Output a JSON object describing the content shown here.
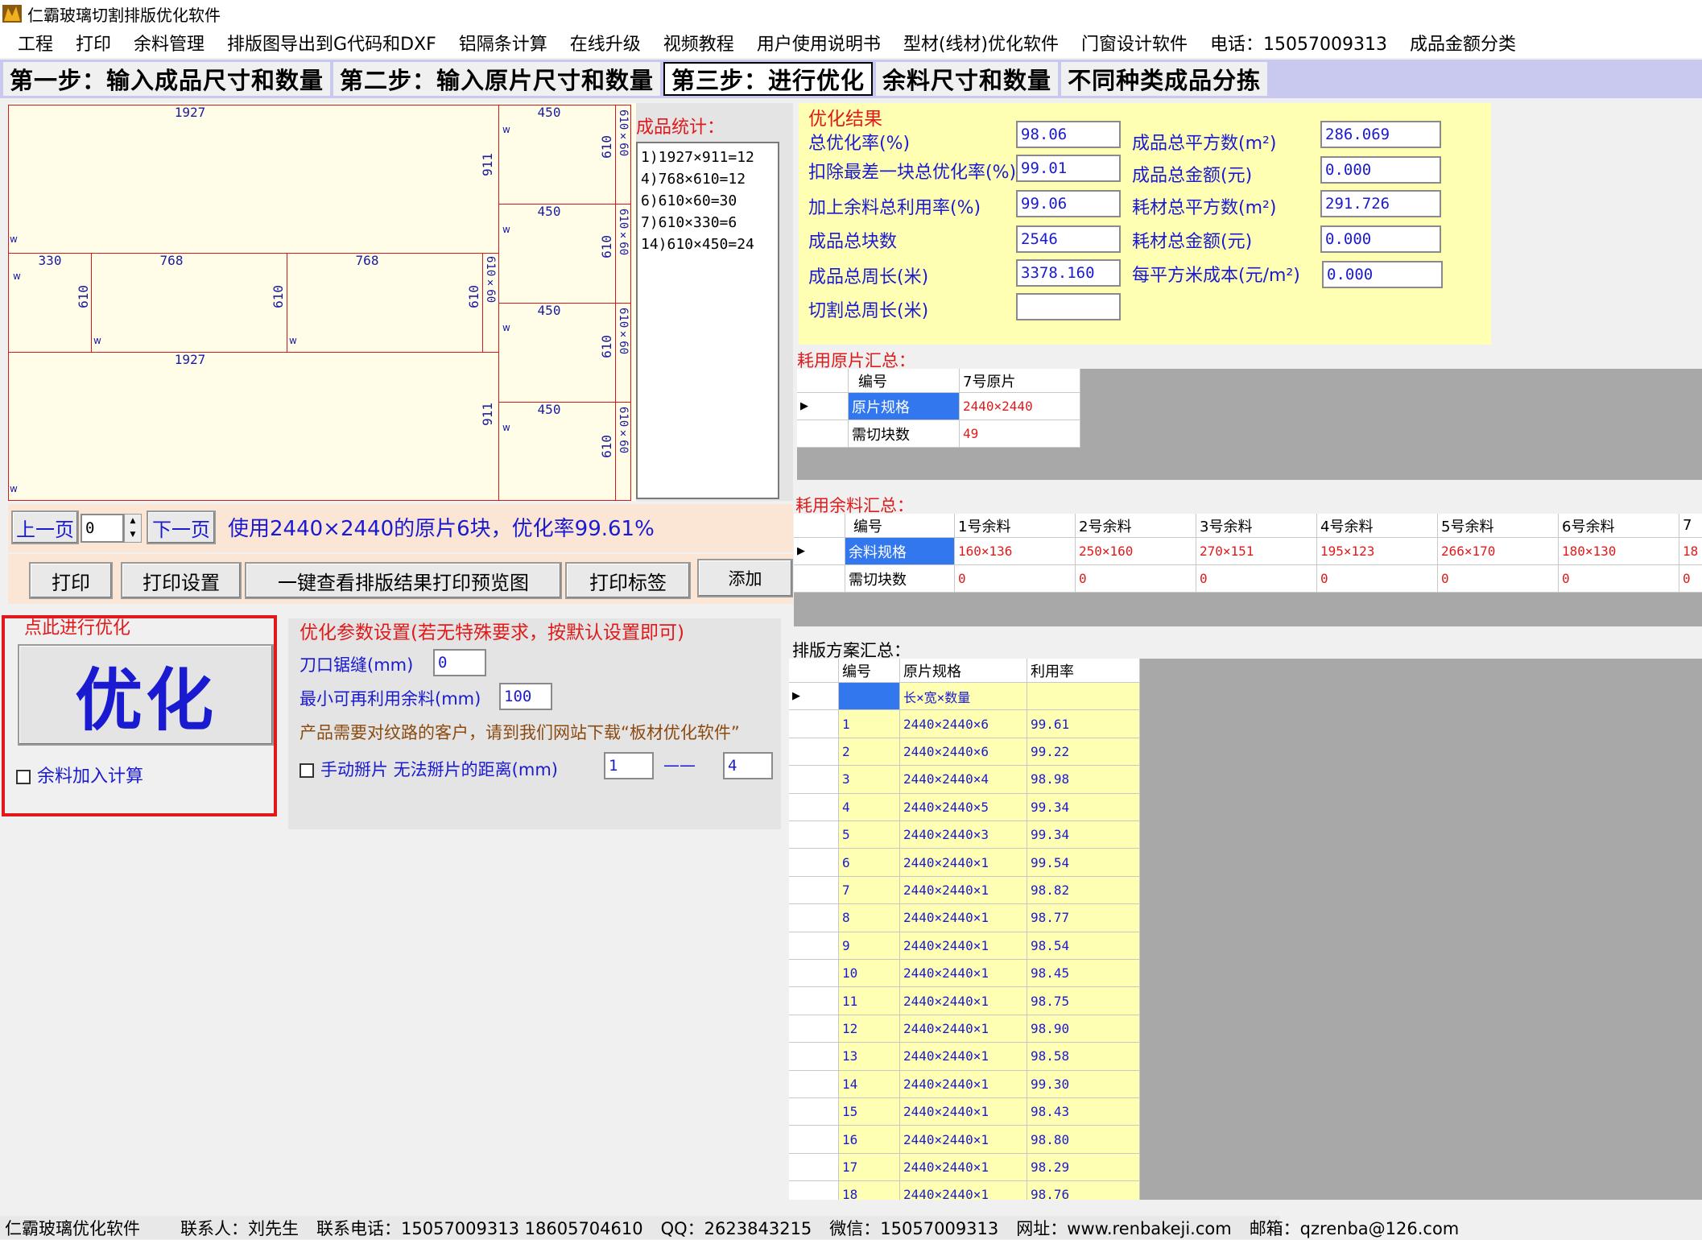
{
  "window": {
    "title": "仁霸玻璃切割排版优化软件"
  },
  "menu": [
    "工程",
    "打印",
    "余料管理",
    "排版图导出到G代码和DXF",
    "铝隔条计算",
    "在线升级",
    "视频教程",
    "用户使用说明书",
    "型材(线材)优化软件",
    "门窗设计软件",
    "电话：15057009313",
    "成品金额分类"
  ],
  "tabs": [
    "第一步：输入成品尺寸和数量",
    "第二步：输入原片尺寸和数量",
    "第三步：进行优化",
    "余料尺寸和数量",
    "不同种类成品分拣"
  ],
  "layout": {
    "pieces": {
      "p1": "1927",
      "p2": "911",
      "p3": "330",
      "p4": "610",
      "p5": "768",
      "p6": "610",
      "p7": "768",
      "p8": "610",
      "p9": "1927",
      "p10": "911",
      "p11": "450",
      "p12": "610",
      "p13": "450",
      "p14": "610",
      "p15": "450",
      "p16": "610",
      "p17": "450",
      "p18": "610",
      "p19": "610×60",
      "p20": "610×60",
      "p21": "610×60",
      "p22": "610×60",
      "p23": "610×60",
      "w": "w"
    }
  },
  "stats": {
    "label": "成品统计：",
    "items": [
      "1)1927×911=12",
      "4)768×610=12",
      "6)610×60=30",
      "7)610×330=6",
      "14)610×450=24"
    ]
  },
  "nav": {
    "prev": "上一页",
    "page": "0",
    "next": "下一页",
    "summary": "使用2440×2440的原片6块，优化率99.61%"
  },
  "buttons": {
    "print": "打印",
    "print_settings": "打印设置",
    "preview": "一键查看排版结果打印预览图",
    "print_label": "打印标签",
    "add": "添加"
  },
  "optimize": {
    "caption": "点此进行优化",
    "button": "优化",
    "checkbox": "余料加入计算"
  },
  "params": {
    "title": "优化参数设置(若无特殊要求，按默认设置即可)",
    "kerf_label": "刀口锯缝(mm)",
    "kerf": "0",
    "minrem_label": "最小可再利用余料(mm)",
    "minrem": "100",
    "note": "产品需要对纹路的客户，请到我们网站下载“板材优化软件”",
    "manual_label": "手动掰片 无法掰片的距离(mm)",
    "dist_from": "1",
    "dash": "——",
    "dist_to": "4"
  },
  "results": {
    "title": "优化结果",
    "left": [
      {
        "label": "总优化率(%)",
        "value": "98.06"
      },
      {
        "label": "扣除最差一块总优化率(%)",
        "value": "99.01"
      },
      {
        "label": "加上余料总利用率(%)",
        "value": "99.06"
      },
      {
        "label": "成品总块数",
        "value": "2546"
      },
      {
        "label": "成品总周长(米)",
        "value": "3378.160"
      },
      {
        "label": "切割总周长(米)",
        "value": ""
      }
    ],
    "right": [
      {
        "label": "成品总平方数(m²)",
        "value": "286.069"
      },
      {
        "label": "成品总金额(元)",
        "value": "0.000"
      },
      {
        "label": "耗材总平方数(m²)",
        "value": "291.726"
      },
      {
        "label": "耗材总金额(元)",
        "value": "0.000"
      },
      {
        "label": "每平方米成本(元/m²)",
        "value": "0.000"
      }
    ]
  },
  "raw": {
    "title": "耗用原片汇总：",
    "h0": "编号",
    "h1": "7号原片",
    "r1": "原片规格",
    "v1": "2440×2440",
    "r2": "需切块数",
    "v2": "49"
  },
  "remnant": {
    "title": "耗用余料汇总：",
    "h0": "编号",
    "headers": [
      "1号余料",
      "2号余料",
      "3号余料",
      "4号余料",
      "5号余料",
      "6号余料",
      "7"
    ],
    "r1": "余料规格",
    "specs": [
      "160×136",
      "250×160",
      "270×151",
      "195×123",
      "266×170",
      "180×130",
      "18"
    ],
    "r2": "需切块数",
    "counts": [
      "0",
      "0",
      "0",
      "0",
      "0",
      "0",
      "0"
    ]
  },
  "plans": {
    "title": "排版方案汇总：",
    "headers": [
      "编号",
      "原片规格",
      "利用率"
    ],
    "first": "长×宽×数量",
    "rows": [
      [
        "1",
        "2440×2440×6",
        "99.61"
      ],
      [
        "2",
        "2440×2440×6",
        "99.22"
      ],
      [
        "3",
        "2440×2440×4",
        "98.98"
      ],
      [
        "4",
        "2440×2440×5",
        "99.34"
      ],
      [
        "5",
        "2440×2440×3",
        "99.34"
      ],
      [
        "6",
        "2440×2440×1",
        "99.54"
      ],
      [
        "7",
        "2440×2440×1",
        "98.82"
      ],
      [
        "8",
        "2440×2440×1",
        "98.77"
      ],
      [
        "9",
        "2440×2440×1",
        "98.54"
      ],
      [
        "10",
        "2440×2440×1",
        "98.45"
      ],
      [
        "11",
        "2440×2440×1",
        "98.75"
      ],
      [
        "12",
        "2440×2440×1",
        "98.90"
      ],
      [
        "13",
        "2440×2440×1",
        "98.58"
      ],
      [
        "14",
        "2440×2440×1",
        "99.30"
      ],
      [
        "15",
        "2440×2440×1",
        "98.43"
      ],
      [
        "16",
        "2440×2440×1",
        "98.80"
      ],
      [
        "17",
        "2440×2440×1",
        "98.29"
      ],
      [
        "18",
        "2440×2440×1",
        "98.76"
      ]
    ]
  },
  "status": [
    "仁霸玻璃优化软件",
    "联系人：刘先生",
    "联系电话：15057009313 18605704610",
    "QQ：2623843215",
    "微信：15057009313",
    "网址：www.renbakeji.com",
    "邮箱：qzrenba@126.com"
  ]
}
